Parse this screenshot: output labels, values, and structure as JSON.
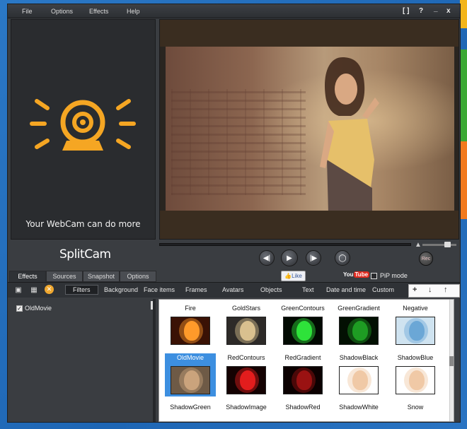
{
  "menu": {
    "file": "File",
    "options": "Options",
    "effects": "Effects",
    "help": "Help"
  },
  "window_controls": {
    "fullscreen": "[ ]",
    "help": "?",
    "minimize": "_",
    "close": "x"
  },
  "logo_panel": {
    "tagline": "Your WebCam can do more"
  },
  "brand": "SplitCam",
  "controls": {
    "rec": "Rec"
  },
  "playback": {
    "volume": 0.7
  },
  "tabs": [
    "Effects",
    "Sources",
    "Snapshot",
    "Options"
  ],
  "like": "Like",
  "youtube": {
    "prefix": "You",
    "suffix": "Tube"
  },
  "pip_mode": "PiP mode",
  "subtabs": [
    "Filters",
    "Background",
    "Face items",
    "Frames",
    "Avatars",
    "Objects",
    "Text",
    "Date and time",
    "Custom"
  ],
  "active_effects": [
    {
      "label": "OldMovie",
      "checked": true
    }
  ],
  "effects_grid": [
    {
      "label": "Fire",
      "tint": "#ff9a2a",
      "bg": "#3a1205"
    },
    {
      "label": "GoldStars",
      "tint": "#d9c08f",
      "bg": "#2d2a28"
    },
    {
      "label": "GreenContours",
      "tint": "#2ee23a",
      "bg": "#020a02"
    },
    {
      "label": "GreenGradient",
      "tint": "#1e9c23",
      "bg": "#031003"
    },
    {
      "label": "Negative",
      "tint": "#6ba7d6",
      "bg": "#cfe3f0"
    },
    {
      "label": "OldMovie",
      "tint": "#caa37c",
      "bg": "#6e5a46"
    },
    {
      "label": "RedContours",
      "tint": "#e21d1d",
      "bg": "#140202"
    },
    {
      "label": "RedGradient",
      "tint": "#9a1212",
      "bg": "#0c0101"
    },
    {
      "label": "ShadowBlack",
      "tint": "#f0c9a6",
      "bg": "#ffffff"
    },
    {
      "label": "ShadowBlue",
      "tint": "#f0c9a6",
      "bg": "#ffffff"
    },
    {
      "label": "ShadowGreen"
    },
    {
      "label": "ShadowImage"
    },
    {
      "label": "ShadowRed"
    },
    {
      "label": "ShadowWhite"
    },
    {
      "label": "Snow"
    }
  ]
}
